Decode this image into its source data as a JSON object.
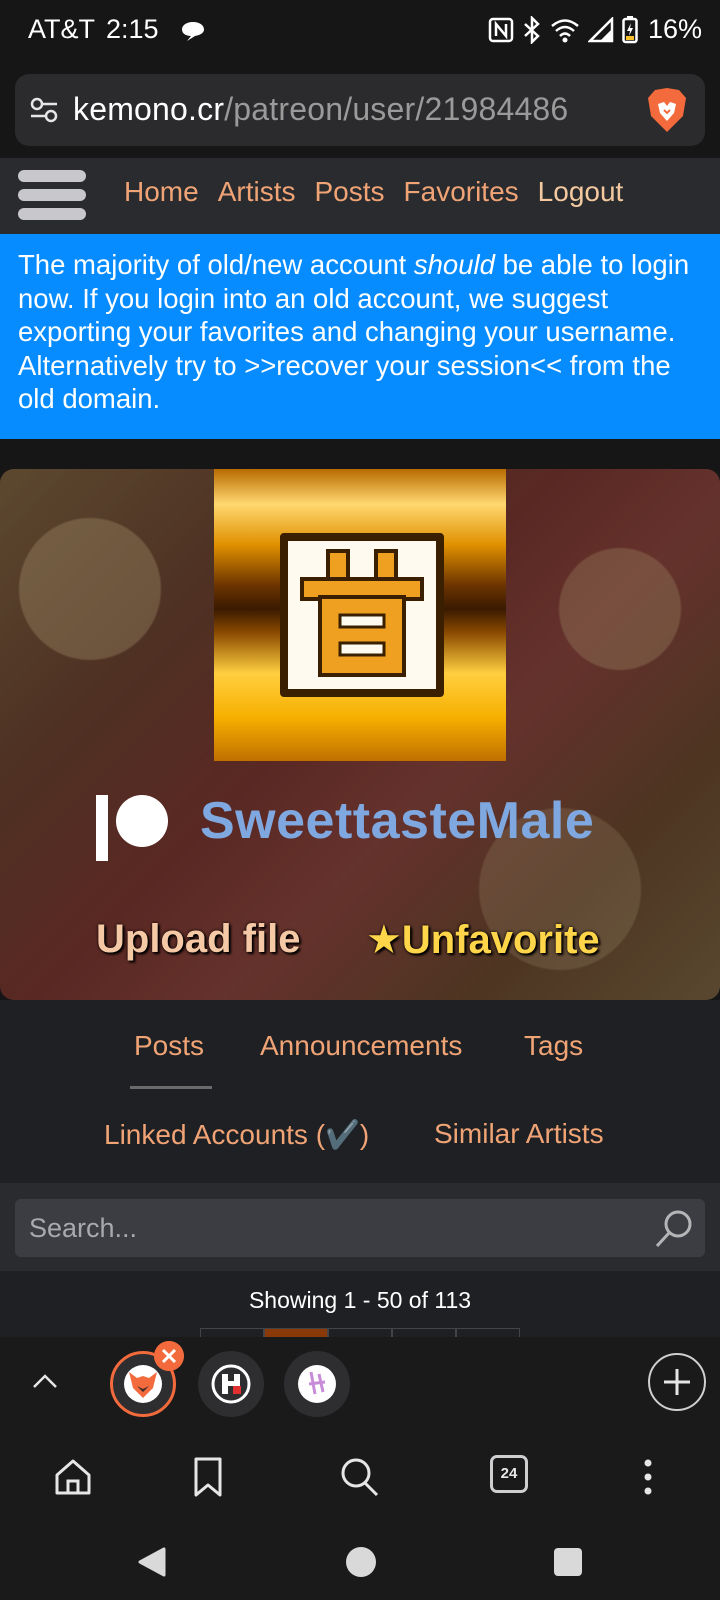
{
  "status_bar": {
    "carrier": "AT&T",
    "time": "2:15",
    "battery": "16%"
  },
  "url_bar": {
    "domain": "kemono.cr",
    "path": "/patreon/user/21984486"
  },
  "site_nav": {
    "links": [
      "Home",
      "Artists",
      "Posts",
      "Favorites",
      "Logout"
    ]
  },
  "announcement": {
    "part1": "The majority of old/new account ",
    "emphasis": "should",
    "part2": " be able to login now. If you login into an old account, we suggest exporting your favorites and changing your username. Alternatively try to >>recover your session<< from the old domain."
  },
  "profile": {
    "artist_name": "SweettasteMale",
    "upload_label": "Upload file",
    "unfavorite_label": "★Unfavorite"
  },
  "tabs": {
    "posts": "Posts",
    "announcements": "Announcements",
    "tags": "Tags",
    "linked_accounts": "Linked Accounts (✔️)",
    "similar_artists": "Similar Artists"
  },
  "search": {
    "placeholder": "Search..."
  },
  "results": {
    "showing": "Showing 1 - 50 of 113"
  },
  "browser_toolbar": {
    "tab_count": "24"
  },
  "colors": {
    "accent": "#f0a476",
    "announce_bg": "#078cff",
    "artist_name": "#7fa8e0",
    "unfavorite": "#ffd54a",
    "brave_orange": "#f36b3c"
  }
}
